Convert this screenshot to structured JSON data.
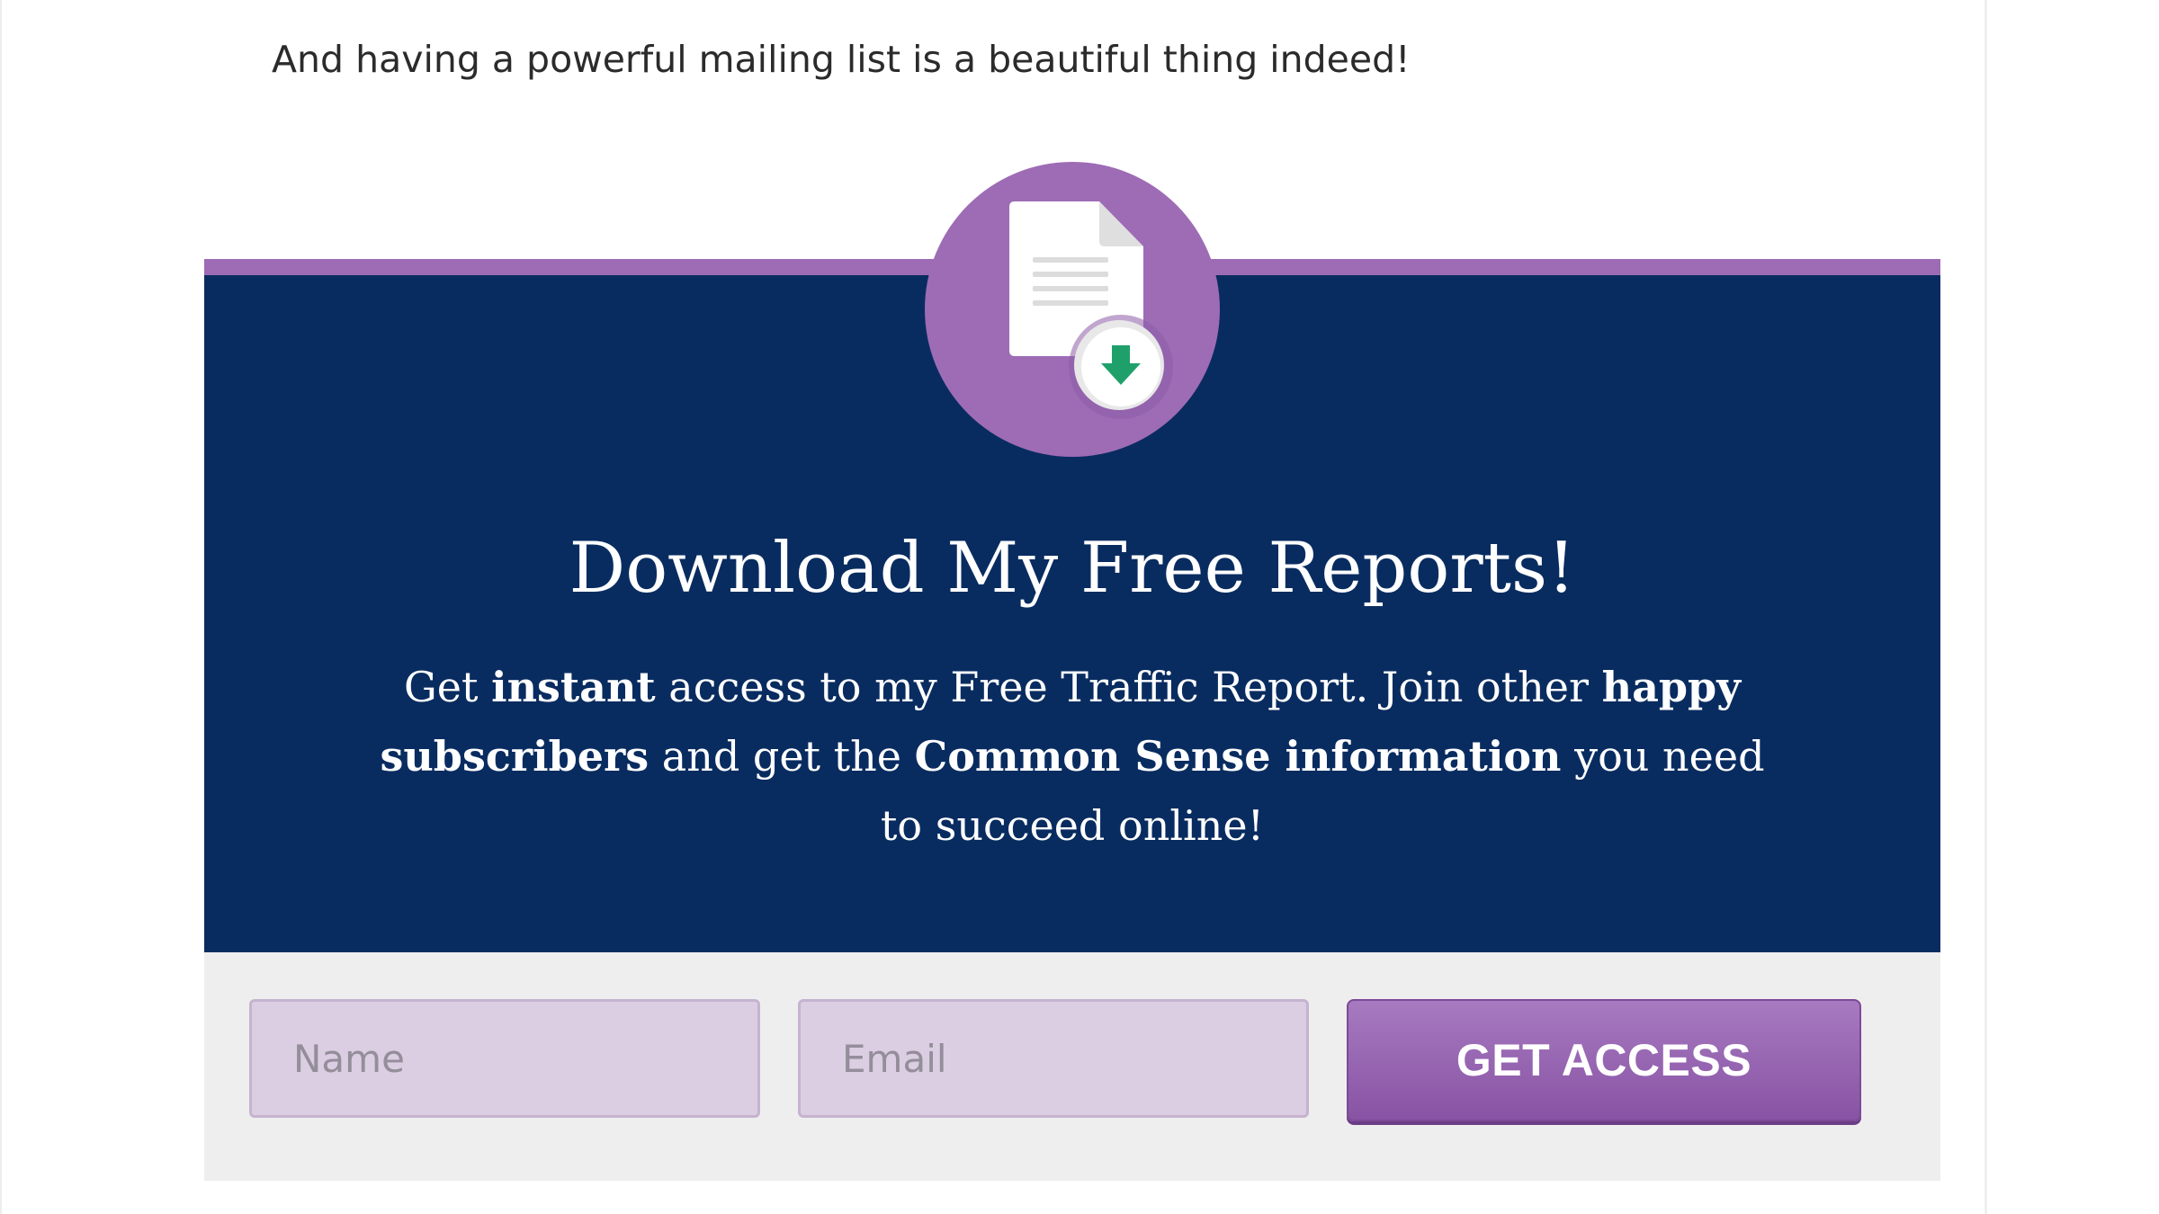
{
  "intro": {
    "text": "And having a powerful mailing list is a beautiful thing indeed!"
  },
  "optin": {
    "icon": "document-download-icon",
    "title": "Download My Free Reports!",
    "body": {
      "part1": "Get ",
      "bold1": "instant",
      "part2": " access to my Free Traffic Report. Join other ",
      "bold2": "happy subscribers",
      "part3": " and get the ",
      "bold3": "Common Sense information",
      "part4": " you need to succeed online!"
    },
    "form": {
      "name_placeholder": "Name",
      "email_placeholder": "Email",
      "submit_label": "GET ACCESS"
    }
  },
  "colors": {
    "accent_purple": "#9d6cb5",
    "header_navy": "#092c60",
    "form_background": "#efeeef",
    "download_green": "#1fa06a"
  }
}
